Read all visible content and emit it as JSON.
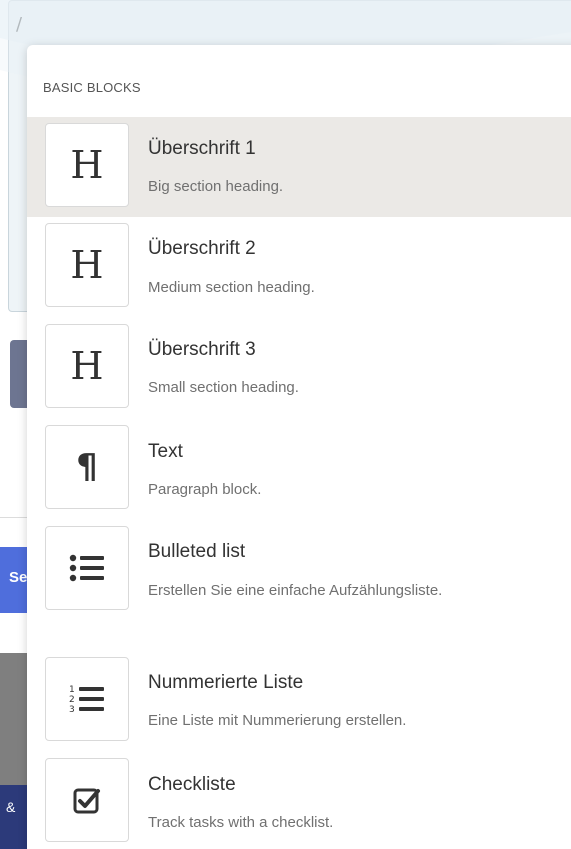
{
  "editor": {
    "input_text": "/"
  },
  "background": {
    "blue_button_fragment": "Se",
    "dark_band_fragment": "&"
  },
  "menu": {
    "section_title": "BASIC BLOCKS",
    "items": [
      {
        "title": "Überschrift 1",
        "description": "Big section heading.",
        "icon": "heading-icon",
        "glyph": "H",
        "selected": true
      },
      {
        "title": "Überschrift 2",
        "description": "Medium section heading.",
        "icon": "heading-icon",
        "glyph": "H",
        "selected": false
      },
      {
        "title": "Überschrift 3",
        "description": "Small section heading.",
        "icon": "heading-icon",
        "glyph": "H",
        "selected": false
      },
      {
        "title": "Text",
        "description": "Paragraph block.",
        "icon": "pilcrow-icon",
        "glyph": "¶",
        "selected": false
      },
      {
        "title": "Bulleted list",
        "description": "Erstellen Sie eine einfache Aufzählungsliste.",
        "icon": "bulleted-list-icon",
        "selected": false
      },
      {
        "title": "Nummerierte Liste",
        "description": "Eine Liste mit Nummerierung erstellen.",
        "icon": "numbered-list-icon",
        "selected": false
      },
      {
        "title": "Checkliste",
        "description": "Track tasks with a checklist.",
        "icon": "checkbox-icon",
        "selected": false
      }
    ]
  },
  "colors": {
    "selected_bg": "#ebe9e6",
    "text": "#333333",
    "muted": "#707070",
    "brand_blue": "#4f6edc"
  }
}
